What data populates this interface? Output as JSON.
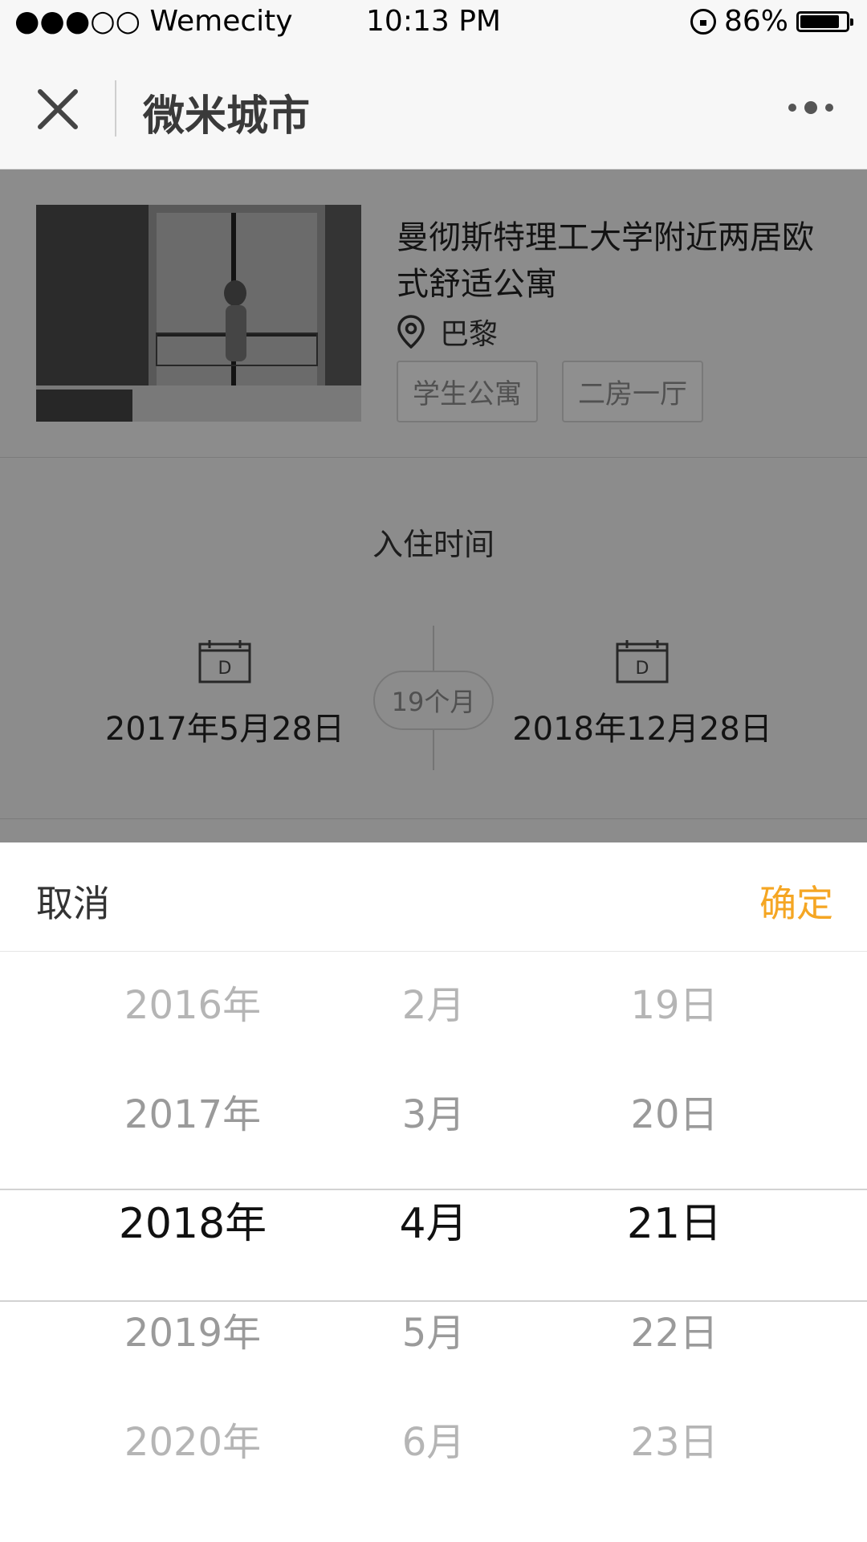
{
  "status_bar": {
    "carrier": "●●●○○ Wemecity",
    "time": "10:13 PM",
    "battery": "86%"
  },
  "nav": {
    "title": "微米城市"
  },
  "listing": {
    "title": "曼彻斯特理工大学附近两居欧式舒适公寓",
    "location": "巴黎",
    "tags": [
      "学生公寓",
      "二房一厅"
    ]
  },
  "checkin": {
    "label": "入住时间",
    "start_date": "2017年5月28日",
    "end_date": "2018年12月28日",
    "duration": "19个月"
  },
  "picker": {
    "cancel_label": "取消",
    "confirm_label": "确定",
    "years": [
      "2016年",
      "2017年",
      "2018年",
      "2019年",
      "2020年"
    ],
    "months": [
      "2月",
      "3月",
      "4月",
      "5月",
      "6月"
    ],
    "days": [
      "19日",
      "20日",
      "21日",
      "22日",
      "23日"
    ],
    "selected": {
      "year": "2018年",
      "month": "4月",
      "day": "21日"
    }
  },
  "colors": {
    "accent": "#f5a623",
    "overlay": "rgba(0,0,0,0.42)"
  }
}
